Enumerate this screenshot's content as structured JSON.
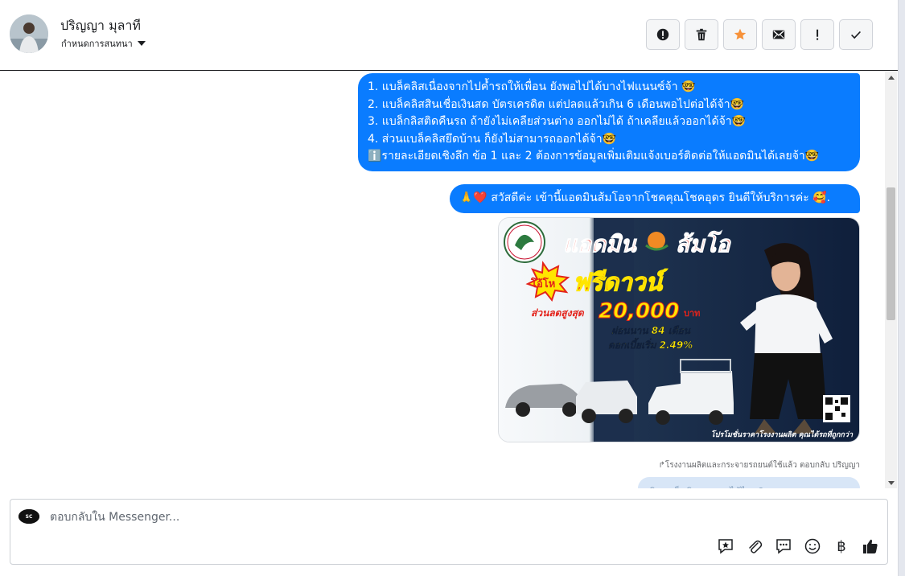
{
  "contact": {
    "name": "ปริญญา มุลาที",
    "status_label": "กำหนดการสนทนา"
  },
  "header_actions": [
    {
      "name": "report-button",
      "icon": "alert-circle-icon"
    },
    {
      "name": "delete-button",
      "icon": "trash-icon"
    },
    {
      "name": "star-button",
      "icon": "star-icon",
      "color": "#f7923a"
    },
    {
      "name": "mark-unread-button",
      "icon": "envelope-icon"
    },
    {
      "name": "important-button",
      "icon": "exclamation-icon"
    },
    {
      "name": "done-button",
      "icon": "checkmark-icon"
    }
  ],
  "messages": {
    "first_lines": [
      "1. แบล็คลิสเนื่องจากไปค้ำรถให้เพื่อน ยังพอไปได้บางไฟแนนซ์จ้า 🤓",
      "2. แบล็คลิสสินเชื่อเงินสด บัตรเครดิต แต่ปลดแล้วเกิน 6 เดือนพอไปต่อได้จ้า🤓",
      "3. แบล็กลิสติดคืนรถ ถ้ายังไม่เคลียส่วนต่าง ออกไม่ได้ ถ้าเคลียแล้วออกได้จ้า🤓",
      "4. ส่วนแบล็คลิสยึดบ้าน ก็ยังไม่สามารถออกได้จ้า🤓",
      "ℹ️รายละเอียดเชิงลึก ข้อ 1 และ 2 ต้องการข้อมูลเพิ่มเติมแจ้งเบอร์ติดต่อให้แอดมินได้เลยจ้า🤓"
    ],
    "greeting": "🙏❤️ สวัสดีค่ะ เข้านี้แอดมินส้มโอจากโชคคุณโชคอุดร ยินดีให้บริการค่ะ 🥰."
  },
  "promo": {
    "headline": "แอดมิน",
    "name": "ส้มโอ",
    "badge": "โอ้โห",
    "offer": "ฟรีดาวน์",
    "discount_label": "ส่วนลดสูงสุด",
    "discount_value": "20,000",
    "discount_unit": "บาท",
    "installment": "ผ่อนนาน 84 เดือน",
    "interest": "ดอกเบี้ยเริ่ม 2.49%",
    "footer": "โปรโมชั่นราคาโรงงานผลิต คุณได้รถที่ถูกกว่า",
    "colors": {
      "red": "#e3231b",
      "yellow": "#ffe600",
      "navy": "#0f1f3b"
    }
  },
  "meta_note": "↱โรงงานผลิตและกระจายรถยนต์ใช้แล้ว ตอบกลับ ปริญญา",
  "next_message_preview": "ติดแบล็คลิส ออกรถได้ไหม?",
  "composer": {
    "placeholder": "ตอบกลับใน Messenger...",
    "page_avatar_label": "SC"
  },
  "tools": [
    {
      "name": "saved-replies-button",
      "icon": "star-chat-icon"
    },
    {
      "name": "attach-button",
      "icon": "paperclip-icon"
    },
    {
      "name": "quick-replies-button",
      "icon": "chat-bubble-icon"
    },
    {
      "name": "emoji-button",
      "icon": "smiley-icon"
    },
    {
      "name": "payment-button",
      "icon": "baht-icon",
      "glyph": "฿"
    },
    {
      "name": "like-button",
      "icon": "thumbs-up-icon"
    }
  ]
}
